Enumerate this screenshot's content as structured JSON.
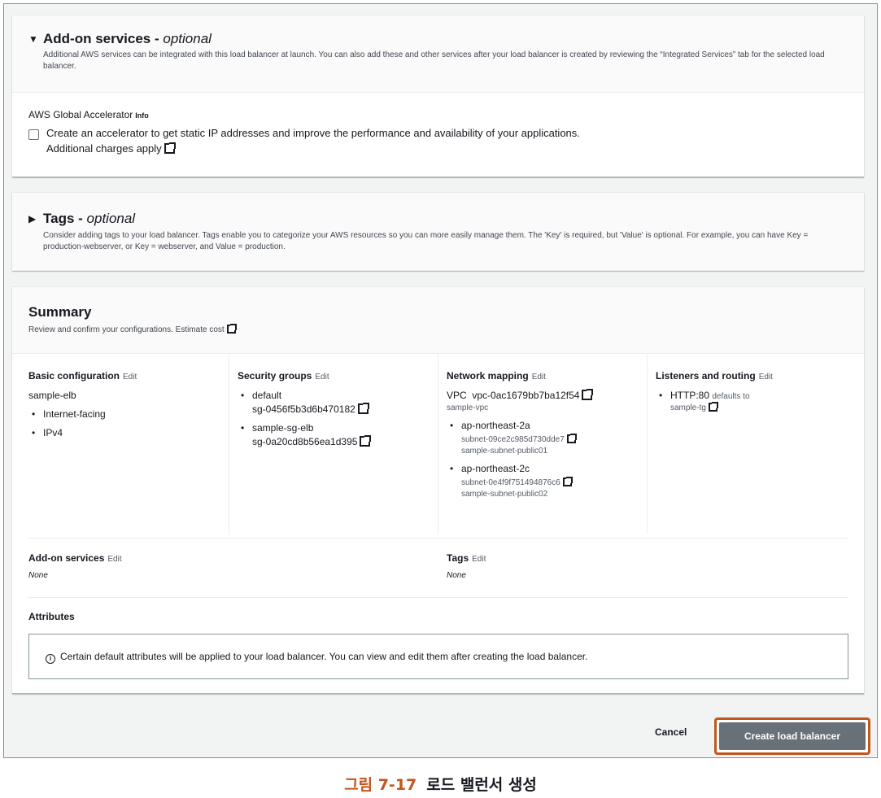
{
  "addon_panel": {
    "title": "Add-on services",
    "title_suffix": "optional",
    "description": "Additional AWS services can be integrated with this load balancer at launch. You can also add these and other services after your load balancer is created by reviewing the “Integrated Services” tab for the selected load balancer.",
    "ga_label": "AWS Global Accelerator",
    "ga_info": "Info",
    "ga_checkbox_text": "Create an accelerator to get static IP addresses and improve the performance and availability of your applications.",
    "ga_charges": "Additional charges apply"
  },
  "tags_panel": {
    "title": "Tags",
    "title_suffix": "optional",
    "description": "Consider adding tags to your load balancer. Tags enable you to categorize your AWS resources so you can more easily manage them. The 'Key' is required, but 'Value' is optional. For example, you can have Key = production-webserver, or Key = webserver, and Value = production."
  },
  "summary": {
    "title": "Summary",
    "description": "Review and confirm your configurations.",
    "estimate_cost": "Estimate cost",
    "edit_label": "Edit",
    "basic": {
      "title": "Basic configuration",
      "name": "sample-elb",
      "items": [
        "Internet-facing",
        "IPv4"
      ]
    },
    "security_groups": {
      "title": "Security groups",
      "items": [
        {
          "name": "default",
          "id": "sg-0456f5b3d6b470182"
        },
        {
          "name": "sample-sg-elb",
          "id": "sg-0a20cd8b56ea1d395"
        }
      ]
    },
    "network": {
      "title": "Network mapping",
      "vpc_label": "VPC",
      "vpc_id": "vpc-0ac1679bb7ba12f54",
      "vpc_name": "sample-vpc",
      "zones": [
        {
          "az": "ap-northeast-2a",
          "subnet": "subnet-09ce2c985d730dde7",
          "subnet_name": "sample-subnet-public01"
        },
        {
          "az": "ap-northeast-2c",
          "subnet": "subnet-0e4f9f751494876c6",
          "subnet_name": "sample-subnet-public02"
        }
      ]
    },
    "listeners": {
      "title": "Listeners and routing",
      "protocol": "HTTP:80",
      "defaults_to": "defaults to",
      "target": "sample-tg"
    },
    "addon": {
      "title": "Add-on services",
      "value": "None"
    },
    "tags": {
      "title": "Tags",
      "value": "None"
    },
    "attributes": {
      "title": "Attributes",
      "notice": "Certain default attributes will be applied to your load balancer. You can view and edit them after creating the load balancer."
    }
  },
  "footer": {
    "cancel": "Cancel",
    "create": "Create load balancer"
  },
  "caption": {
    "figure": "그림 7-17",
    "text": "로드 밸런서 생성"
  },
  "colors": {
    "highlight": "#c2561d",
    "primary_button": "#687078"
  }
}
